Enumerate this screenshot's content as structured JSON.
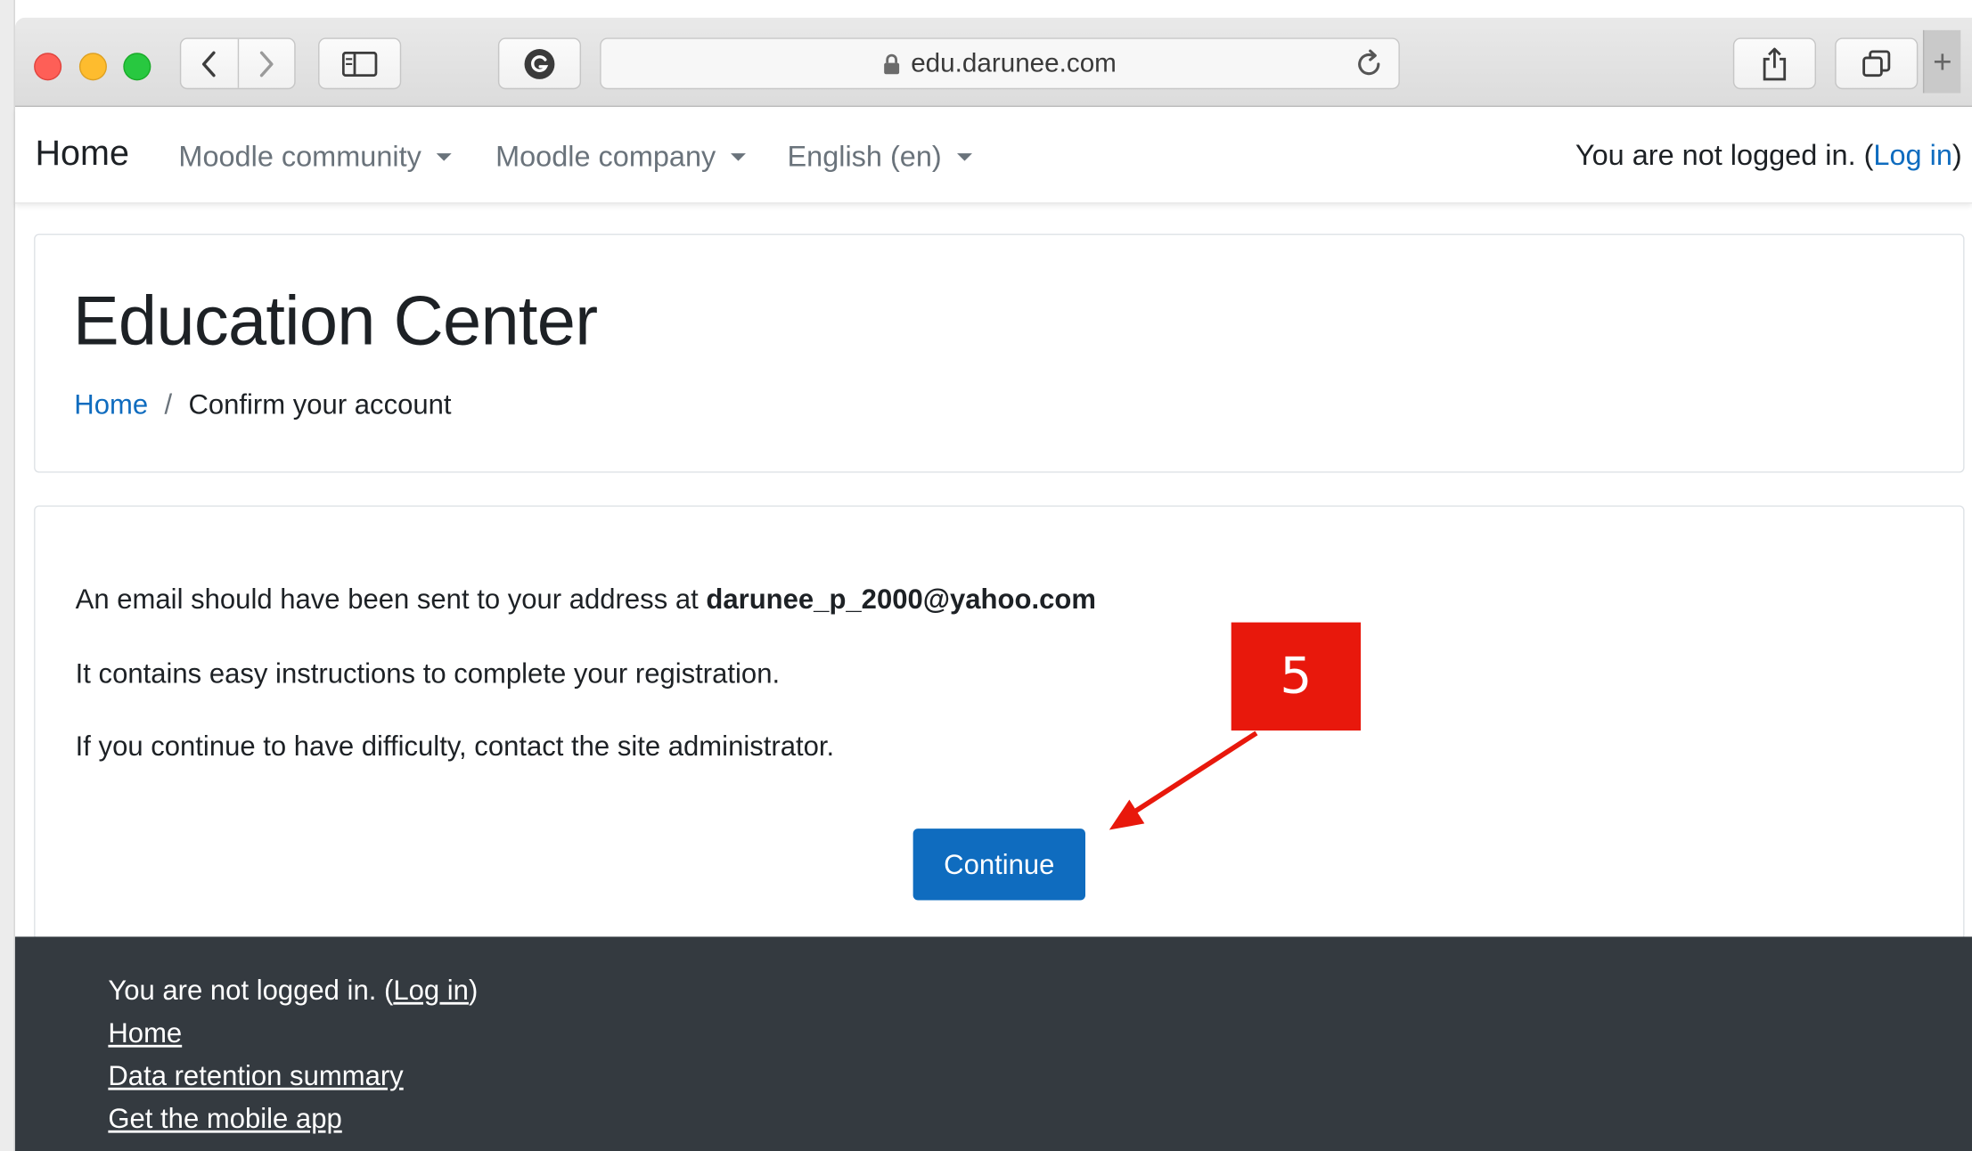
{
  "browser": {
    "url": "edu.darunee.com",
    "new_tab_glyph": "+"
  },
  "navbar": {
    "brand": "Home",
    "menus": [
      {
        "label": "Moodle community"
      },
      {
        "label": "Moodle company"
      },
      {
        "label": "English (en)"
      }
    ],
    "login_prefix": "You are not logged in. (",
    "login_link": "Log in",
    "login_suffix": ")"
  },
  "header": {
    "title": "Education Center",
    "breadcrumb": {
      "home": "Home",
      "separator": "/",
      "current": "Confirm your account"
    }
  },
  "content": {
    "line1_prefix": "An email should have been sent to your address at ",
    "email": "darunee_p_2000@yahoo.com",
    "line2": "It contains easy instructions to complete your registration.",
    "line3": "If you continue to have difficulty, contact the site administrator.",
    "continue_label": "Continue"
  },
  "annotation": {
    "step_number": "5",
    "color": "#e8180c"
  },
  "footer": {
    "login_prefix": "You are not logged in. (",
    "login_link": "Log in",
    "login_suffix": ")",
    "links": [
      "Home",
      "Data retention summary",
      "Get the mobile app"
    ]
  },
  "colors": {
    "primary": "#0f6cbf",
    "footer_bg": "#343a40"
  }
}
